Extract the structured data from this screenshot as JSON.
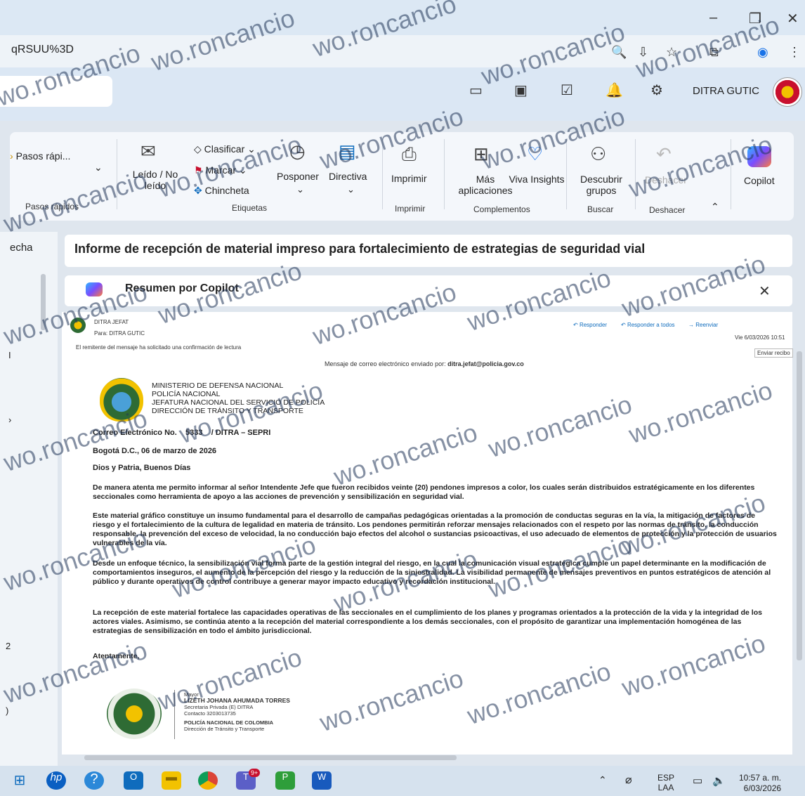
{
  "browser": {
    "url_fragment": "qRSUU%3D",
    "window_controls": [
      "–",
      "❐",
      "✕"
    ]
  },
  "header": {
    "user_name": "DITRA GUTIC"
  },
  "ribbon": {
    "quick_steps": "Pasos rápi...",
    "quick_steps_group": "Pasos rápidos",
    "read_unread": "Leído / No leído",
    "classify": "Clasificar",
    "mark": "Marcar",
    "pin": "Chincheta",
    "tags_group": "Etiquetas",
    "postpone": "Posponer",
    "policy": "Directiva",
    "print": "Imprimir",
    "print_group": "Imprimir",
    "more_apps": "Más aplicaciones",
    "viva": "Viva Insights",
    "addins_group": "Complementos",
    "discover": "Descubrir grupos",
    "search_group": "Buscar",
    "undo": "Deshacer",
    "undo_group": "Deshacer",
    "copilot": "Copilot"
  },
  "left_pane": {
    "date_label": "echa",
    "items": [
      "I",
      "›",
      "2",
      ")"
    ]
  },
  "email": {
    "subject": "Informe de recepción de material impreso para fortalecimiento de estrategias de seguridad vial",
    "copilot_summary": "Resumen por Copilot",
    "from": "DITRA JEFAT",
    "to": "Para: DITRA GUTIC",
    "read_receipt": "El remitente del mensaje ha solicitado una confirmación de lectura",
    "reply": "Responder",
    "reply_all": "Responder a todos",
    "forward": "Reenviar",
    "datetime": "Vie 6/03/2026 10:51",
    "send_receipt": "Enviar recibo",
    "sent_by": "Mensaje de correo electrónico enviado por:",
    "sender_address": "ditra.jefat@policia.gov.co",
    "letterhead": [
      "MINISTERIO DE DEFENSA NACIONAL",
      "POLICÍA NACIONAL",
      "JEFATURA NACIONAL DEL SERVICIO DE POLICÍA",
      "DIRECCIÓN DE TRÁNSITO Y TRANSPORTE"
    ],
    "ref_label": "Correo Electrónico No.",
    "ref_number": "5333",
    "ref_unit": "/ DITRA – SEPRI",
    "place_date": "Bogotá D.C., 06 de marzo de 2026",
    "greeting": "Dios y Patria, Buenos Días",
    "paragraphs": [
      "De manera atenta me permito informar al señor Intendente Jefe que fueron recibidos veinte (20) pendones impresos a color, los cuales serán distribuidos estratégicamente en los diferentes seccionales como herramienta de apoyo a las acciones de prevención y sensibilización en seguridad vial.",
      "Este material gráfico constituye un insumo fundamental para el desarrollo de campañas pedagógicas orientadas a la promoción de conductas seguras en la vía, la mitigación de factores de riesgo y el fortalecimiento de la cultura de legalidad en materia de tránsito. Los pendones permitirán reforzar mensajes relacionados con el respeto por las normas de tránsito, la conducción responsable, la prevención del exceso de velocidad, la no conducción bajo efectos del alcohol o sustancias psicoactivas, el uso adecuado de elementos de protección y la protección de usuarios vulnerables de la vía.",
      "Desde un enfoque técnico, la sensibilización vial forma parte de la gestión integral del riesgo, en la cual la comunicación visual estratégica cumple un papel determinante en la modificación de comportamientos inseguros, el aumento de la percepción del riesgo y la reducción de la siniestralidad. La visibilidad permanente de mensajes preventivos en puntos estratégicos de atención al público y durante operativos de control contribuye a generar mayor impacto educativo y recordación institucional.",
      "La recepción de este material fortalece las capacidades operativas de las seccionales en el cumplimiento de los planes y programas orientados a la protección de la vida y la integridad de los actores viales. Asimismo, se continúa atento a la recepción del material correspondiente a los demás seccionales, con el propósito de garantizar una implementación homogénea de las estrategias de sensibilización en todo el ámbito jurisdiccional."
    ],
    "closing": "Atentamente,",
    "signature": {
      "rank": "Mayor",
      "name": "LIZETH JOHANA AHUMADA TORRES",
      "role": "Secretaria Privada (E) DITRA",
      "contact": "Contacto 3203013735",
      "institution": "POLICÍA NACIONAL DE COLOMBIA",
      "unit": "Dirección de Tránsito y Transporte"
    }
  },
  "taskbar": {
    "language": "ESP",
    "layout": "LAA",
    "time": "10:57 a. m.",
    "date": "6/03/2026",
    "teams_badge": "9+"
  },
  "watermark": "wo.roncancio",
  "colors": {
    "accent": "#0f6cbd",
    "flag": "#c8102e",
    "gold": "#f2c200",
    "police_green": "#2e6b34"
  }
}
